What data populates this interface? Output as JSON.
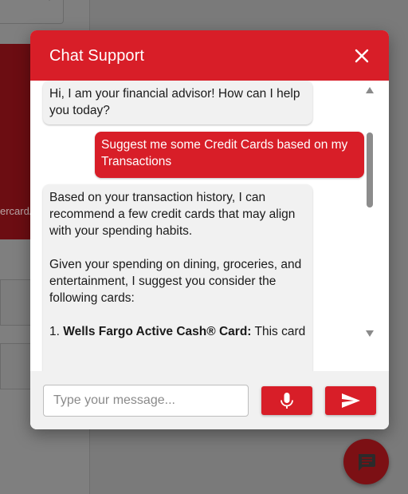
{
  "background": {
    "card_text": "ercardA"
  },
  "chat": {
    "title": "Chat Support",
    "close_icon": "close-icon",
    "messages": [
      {
        "role": "bot",
        "text": "Hi, I am your financial advisor! How can I help you today?"
      },
      {
        "role": "user",
        "text": "Suggest me some Credit Cards based on my Transactions"
      },
      {
        "role": "bot",
        "p1": "Based on your transaction history, I can recommend a few credit cards that may align with your spending habits.",
        "p2": "Given your spending on dining, groceries, and entertainment, I suggest you consider the following cards:",
        "p3_prefix": "1. ",
        "p3_bold": "Wells Fargo Active Cash® Card:",
        "p3_rest": " This card"
      }
    ],
    "input": {
      "placeholder": "Type your message...",
      "value": ""
    },
    "mic_icon": "microphone-icon",
    "send_icon": "send-icon"
  },
  "fab_icon": "chat-bubble-icon",
  "colors": {
    "accent": "#d81e28",
    "bot_bubble": "#f1f1f1",
    "fab": "#7c1014"
  }
}
